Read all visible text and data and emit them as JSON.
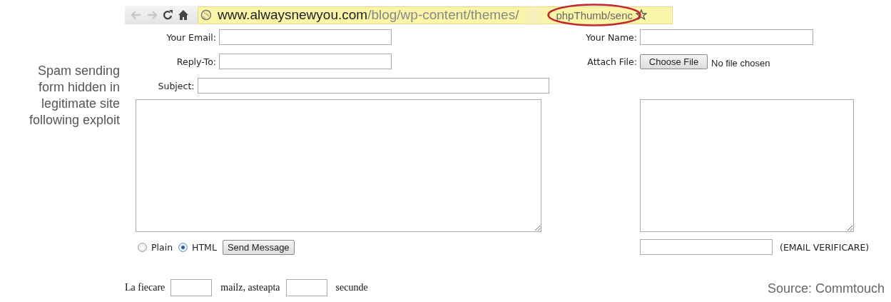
{
  "caption": "Spam sending form hidden in legitimate site following exploit",
  "browser": {
    "url_host": "www.alwaysnewyou.com",
    "url_path": "/blog/wp-content/themes/",
    "url_tail": "phpThumb/senc"
  },
  "form": {
    "email_label": "Your Email:",
    "name_label": "Your Name:",
    "reply_to_label": "Reply-To:",
    "attach_label": "Attach File:",
    "choose_file_button": "Choose File",
    "no_file_text": "No file chosen",
    "subject_label": "Subject:",
    "formats": [
      {
        "label": "Plain",
        "selected": false
      },
      {
        "label": "HTML",
        "selected": true
      }
    ],
    "send_button": "Send Message",
    "verify_label": "(EMAIL VERIFICARE)",
    "delay_texts": [
      "La fiecare",
      "mailz, asteapta",
      "secunde"
    ]
  },
  "source": "Source: Commtouch"
}
